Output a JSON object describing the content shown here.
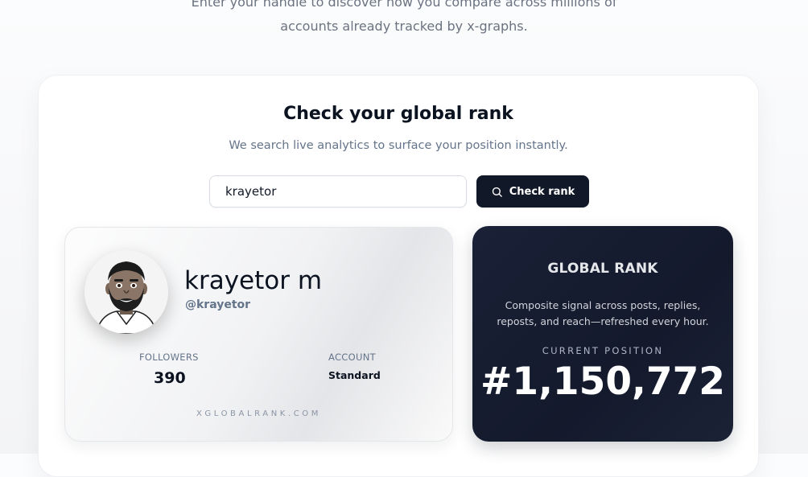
{
  "hero": {
    "subtitle_line1": "Enter your handle to discover how you compare across millions of",
    "subtitle_line2": "accounts already tracked by x-graphs."
  },
  "checker": {
    "title": "Check your global rank",
    "subtitle": "We search live analytics to surface your position instantly.",
    "input_value": "krayetor",
    "button_label": "Check rank",
    "button_icon": "search-icon"
  },
  "profile": {
    "display_name": "krayetor m",
    "handle": "@krayetor",
    "avatar": "cartoon-avatar-bearded-man",
    "followers_label": "FOLLOWERS",
    "followers_value": "390",
    "account_label": "ACCOUNT",
    "account_value": "Standard",
    "brand": "XGLOBALRANK.COM"
  },
  "rank": {
    "title": "GLOBAL RANK",
    "description": "Composite signal across posts, replies, reposts, and reach—refreshed every hour.",
    "position_label": "CURRENT POSITION",
    "position_value": "#1,150,772"
  },
  "colors": {
    "primary_dark": "#111827",
    "rank_card_bg": "#161c2e",
    "muted_text": "#64748b",
    "page_bg": "#f6f7f9"
  }
}
